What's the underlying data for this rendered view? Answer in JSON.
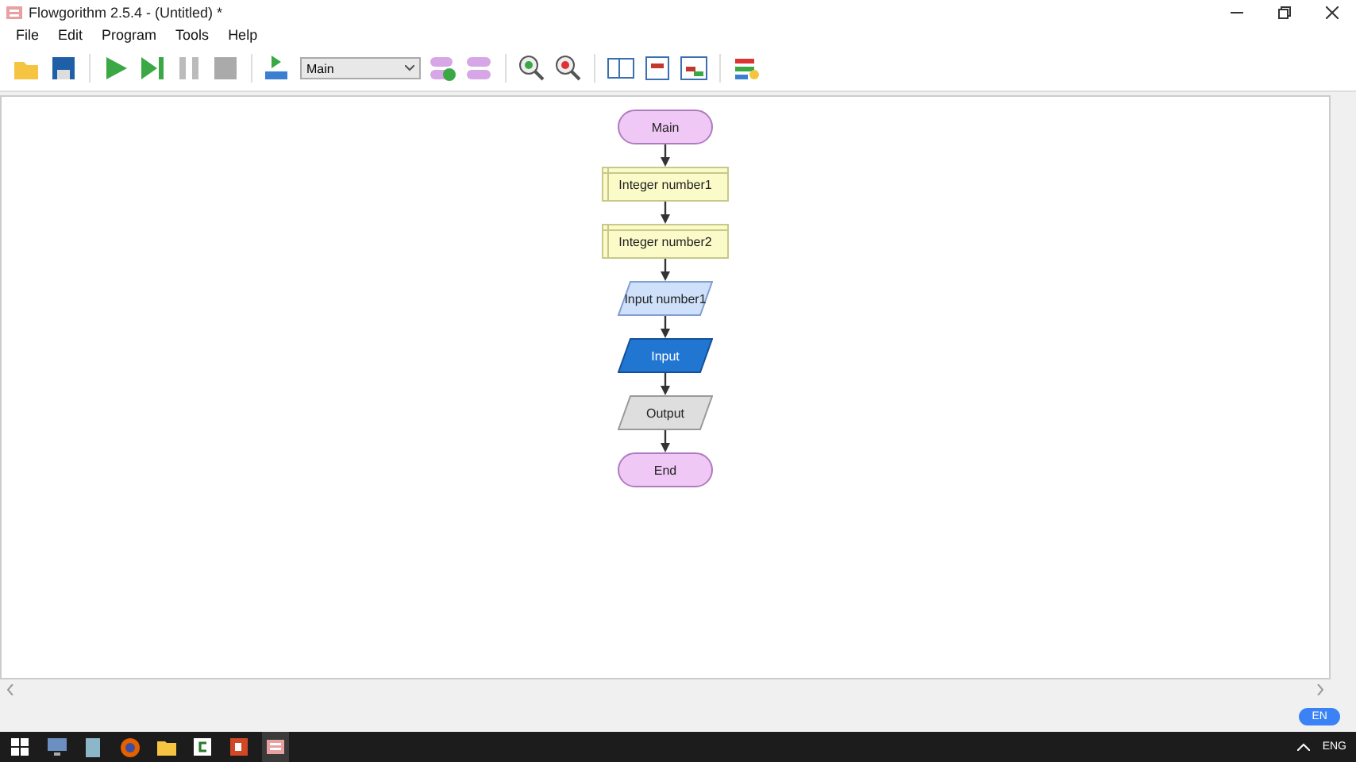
{
  "window": {
    "title": "Flowgorithm 2.5.4 - (Untitled) *"
  },
  "menu": [
    "File",
    "Edit",
    "Program",
    "Tools",
    "Help"
  ],
  "toolbar": {
    "function_select": "Main"
  },
  "flowchart": [
    {
      "kind": "terminal",
      "label": "Main",
      "selected": false
    },
    {
      "kind": "declare",
      "label": "Integer number1",
      "selected": false
    },
    {
      "kind": "declare",
      "label": "Integer number2",
      "selected": false
    },
    {
      "kind": "input",
      "label": "Input number1",
      "selected": false
    },
    {
      "kind": "input",
      "label": "Input",
      "selected": true
    },
    {
      "kind": "output",
      "label": "Output",
      "selected": false
    },
    {
      "kind": "terminal",
      "label": "End",
      "selected": false
    }
  ],
  "status": {
    "language": "EN"
  },
  "taskbar": {
    "language": "ENG"
  }
}
